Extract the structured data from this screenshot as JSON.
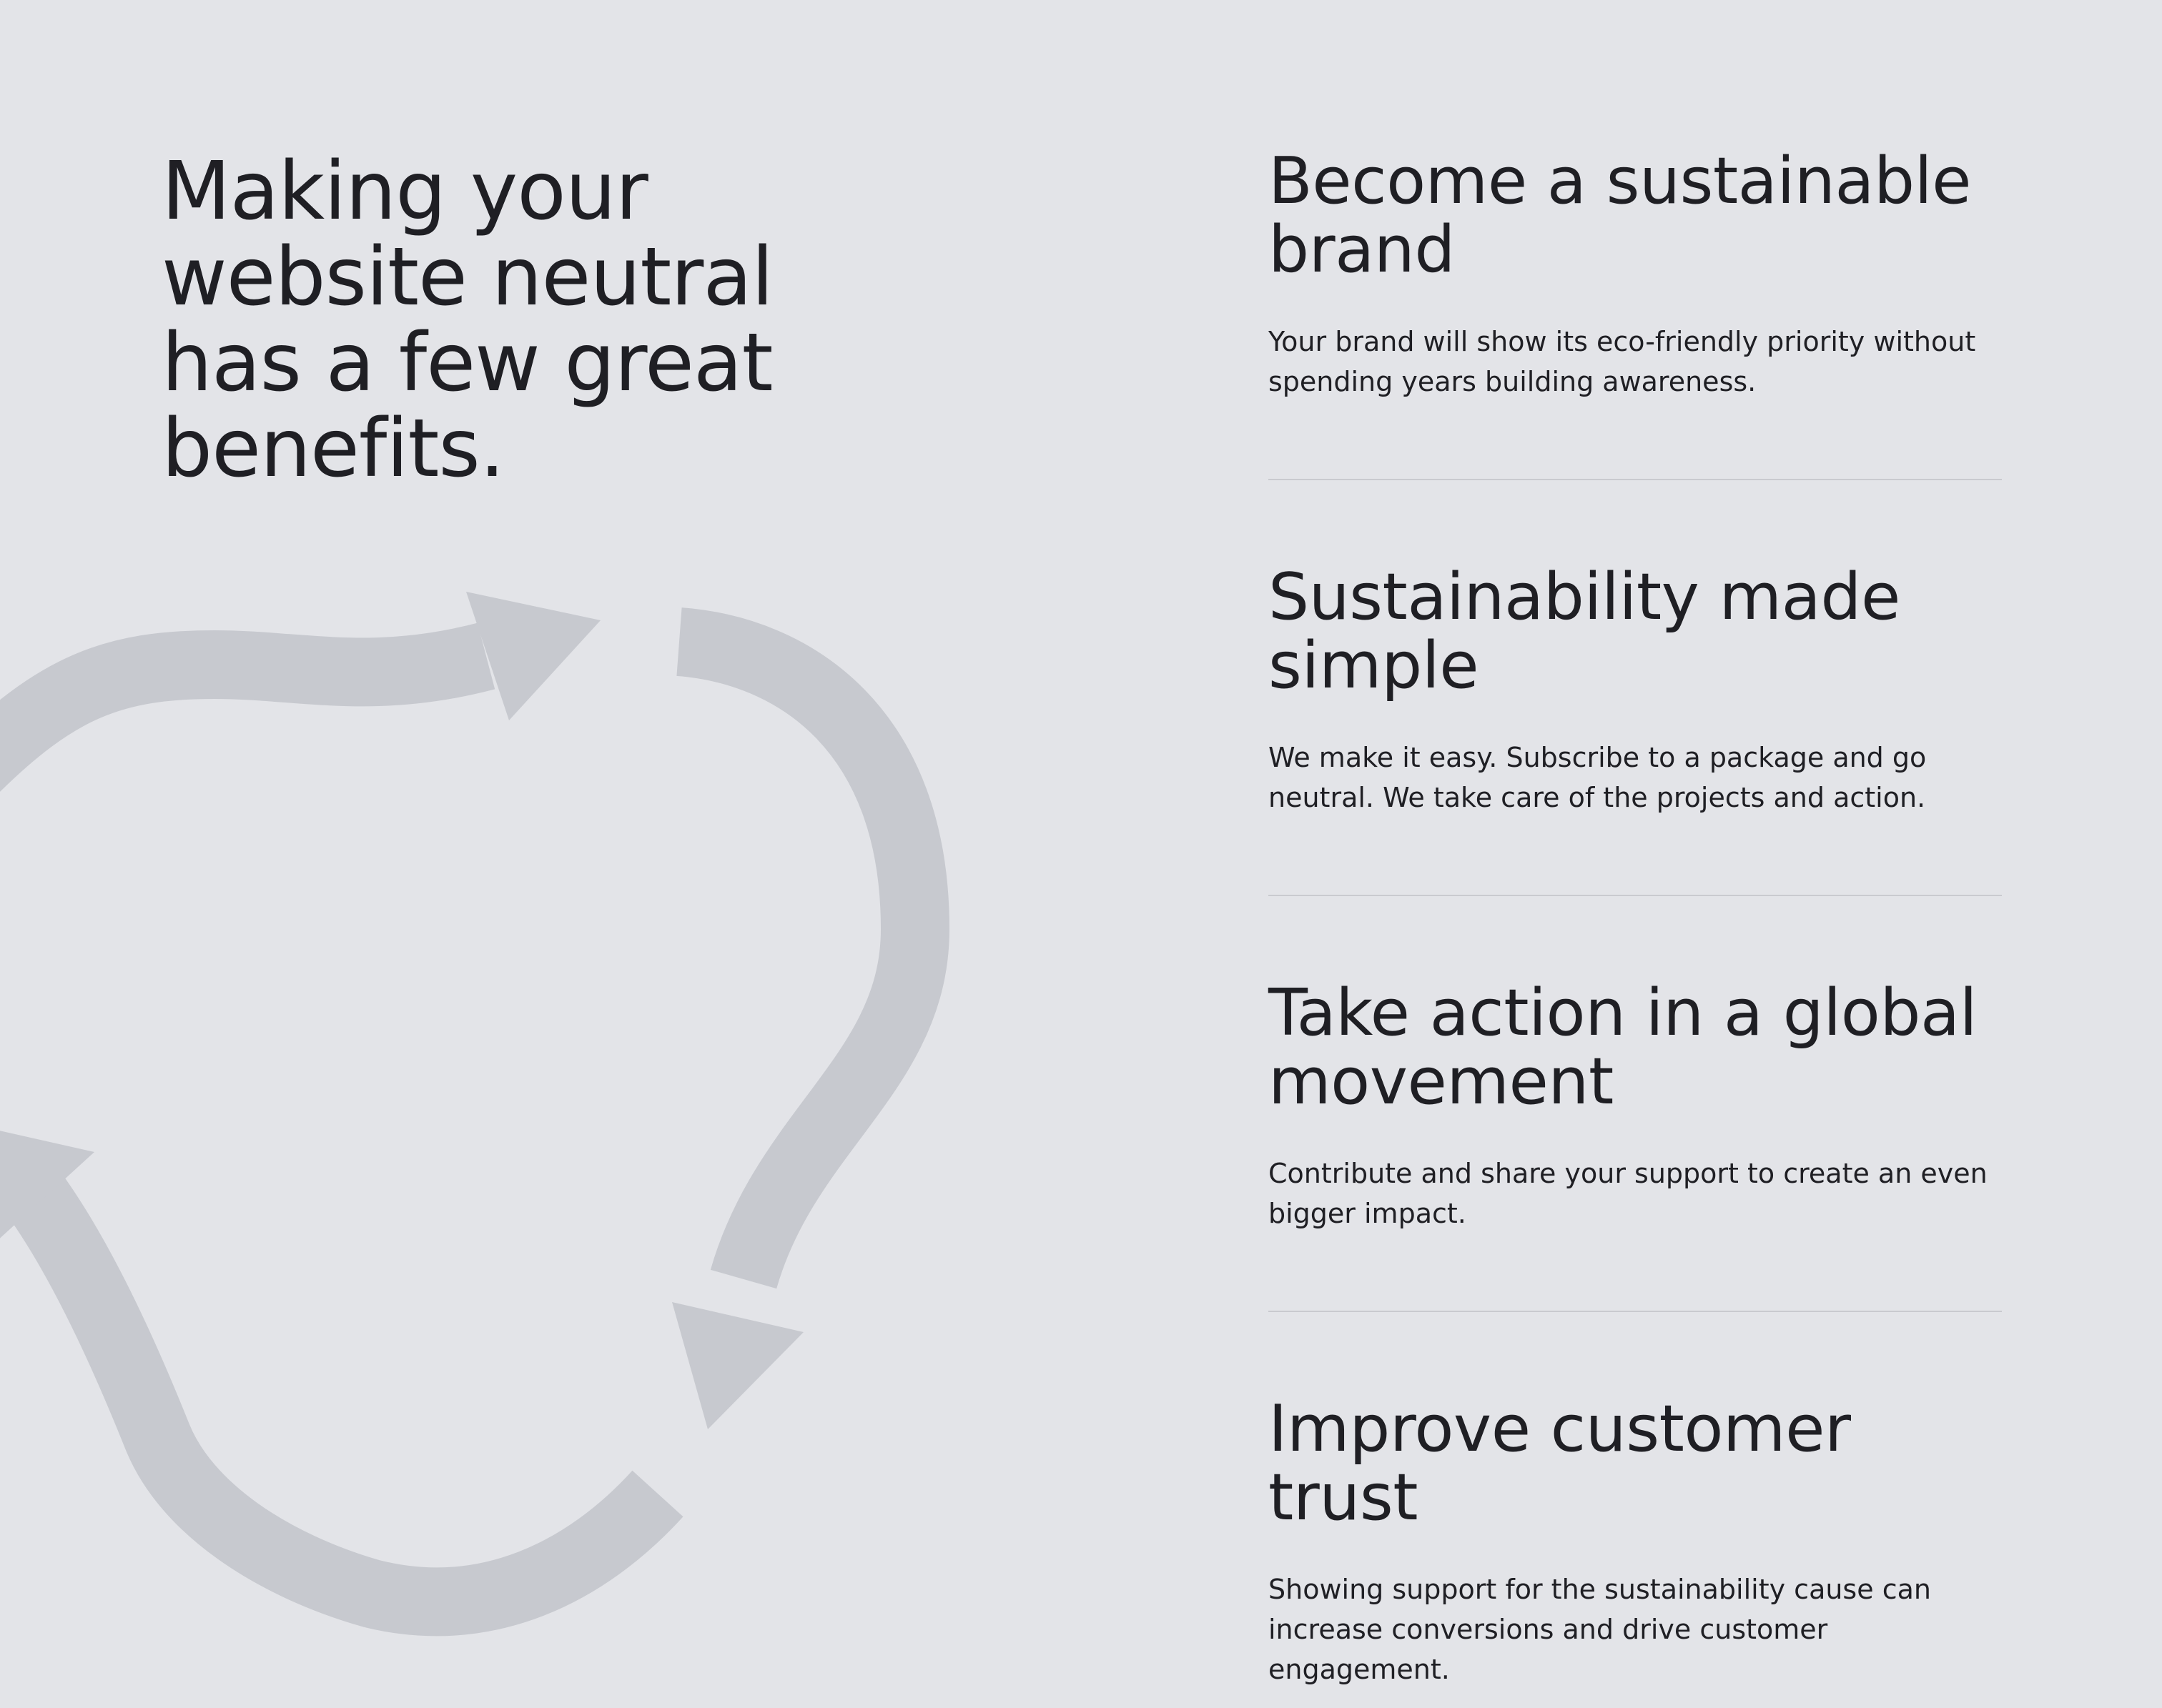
{
  "headline": "Making your website neutral has a few great benefits.",
  "benefits": [
    {
      "title": "Become a sustainable brand",
      "description": "Your brand will show its eco-friendly priority without spending years building awareness."
    },
    {
      "title": "Sustainability made simple",
      "description": "We make it easy. Subscribe to a package and go neutral. We take care of the projects and action."
    },
    {
      "title": "Take action in a global movement",
      "description": "Contribute and share your support to create an even bigger impact."
    },
    {
      "title": "Improve customer trust",
      "description": "Showing support for the sustainability cause can increase conversions and drive customer engagement."
    }
  ],
  "colors": {
    "background": "#e3e4e8",
    "text": "#1f1f24",
    "arrows": "#c7c9cf",
    "divider": "#c9cacf"
  },
  "icons": {
    "cycle": "recycle-arrows-icon"
  }
}
